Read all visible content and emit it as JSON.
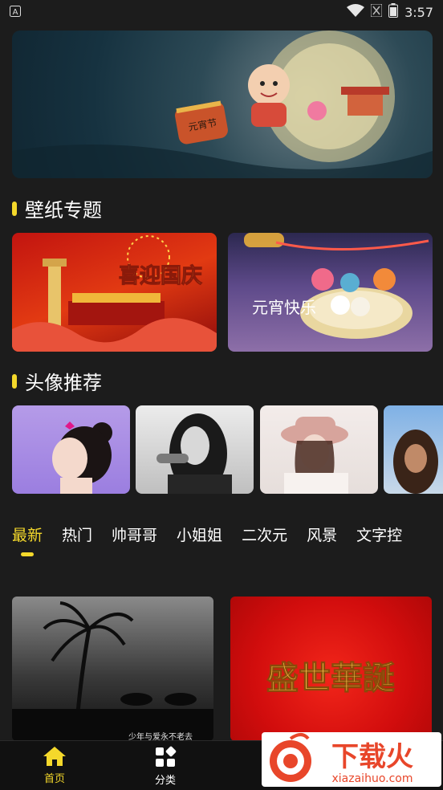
{
  "status_bar": {
    "time": "3:57",
    "notification_icon": "a-square-icon",
    "wifi_icon": "wifi-icon",
    "signal_icon": "signal-muted-icon",
    "battery_icon": "battery-icon"
  },
  "banner": {
    "image": "mid-autumn-moon-illustration",
    "lantern_text": "元宵节"
  },
  "sections": {
    "wallpaper_topics": "壁纸专题",
    "avatar_recommend": "头像推荐"
  },
  "topics": [
    {
      "image": "national-day-celebration",
      "text": "喜迎国庆"
    },
    {
      "image": "lantern-festival-dumplings",
      "text": "元宵快乐"
    }
  ],
  "avatars": [
    {
      "image": "girl-purple-background"
    },
    {
      "image": "girl-black-white-drinking"
    },
    {
      "image": "girl-pink-hat"
    },
    {
      "image": "person-sky-partial"
    }
  ],
  "tabs": [
    {
      "label": "最新",
      "active": true
    },
    {
      "label": "热门",
      "active": false
    },
    {
      "label": "帅哥哥",
      "active": false
    },
    {
      "label": "小姐姐",
      "active": false
    },
    {
      "label": "二次元",
      "active": false
    },
    {
      "label": "风景",
      "active": false
    },
    {
      "label": "文字控",
      "active": false
    }
  ],
  "grid": [
    {
      "image": "palm-tree-horses-grayscale",
      "caption": "少年与爱永不老去"
    },
    {
      "image": "red-gold-calligraphy",
      "caption": "盛世華誕"
    }
  ],
  "bottom_nav": [
    {
      "label": "首页",
      "icon": "home-icon",
      "active": true
    },
    {
      "label": "分类",
      "icon": "grid-icon",
      "active": false
    }
  ],
  "watermark": {
    "name": "下载火",
    "url": "xiazaihuo.com"
  },
  "colors": {
    "accent": "#f4d82b",
    "background": "#1c1c1c"
  }
}
